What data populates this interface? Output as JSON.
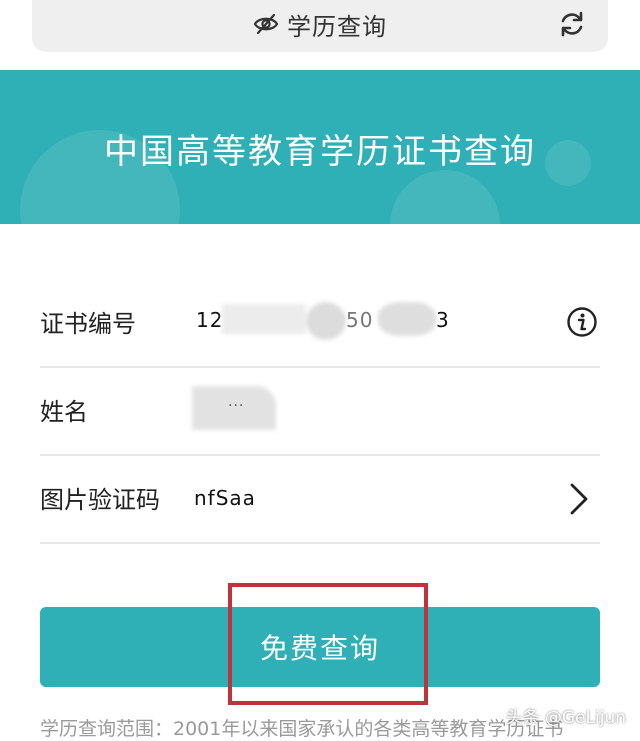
{
  "browser": {
    "title": "学历查询",
    "title_icon": "eye-slash-icon",
    "refresh_icon": "refresh-icon"
  },
  "banner": {
    "title": "中国高等教育学历证书查询",
    "color": "#2fafb6"
  },
  "form": {
    "certificate_number": {
      "label": "证书编号",
      "value_visible_start": "12",
      "value_visible_mid": "50",
      "value_visible_end": "3",
      "help_icon": "info-icon"
    },
    "name": {
      "label": "姓名",
      "value_mask": "..."
    },
    "captcha": {
      "label": "图片验证码",
      "value": "nfSaa",
      "icon": "chevron-right-icon"
    }
  },
  "submit": {
    "label": "免费查询",
    "color": "#2fafb6",
    "highlight_color": "#c0333a"
  },
  "footer": {
    "note": "学历查询范围：2001年以来国家承认的各类高等教育学历证书"
  },
  "watermark": {
    "text": "头条 @GeLijun"
  }
}
